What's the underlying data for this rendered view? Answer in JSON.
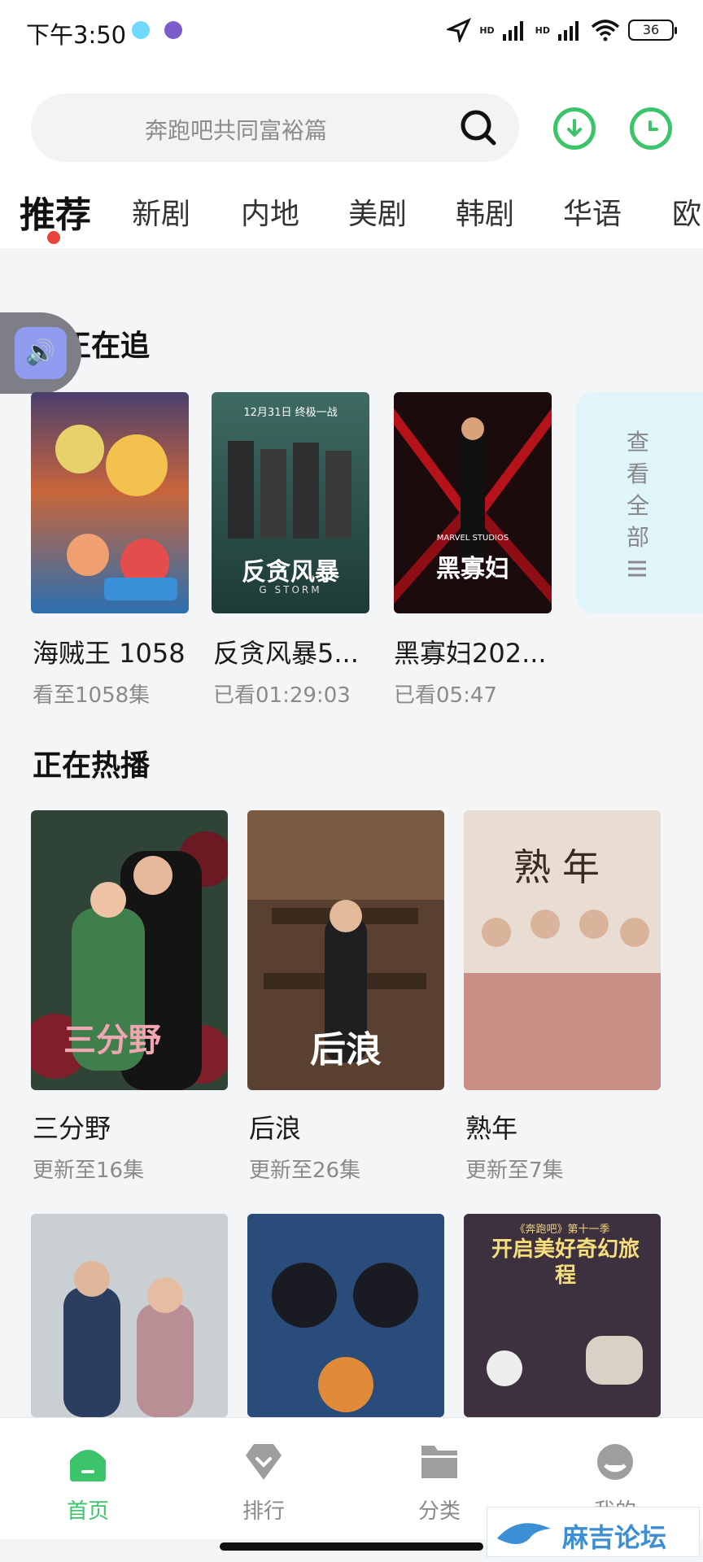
{
  "status_bar": {
    "time": "下午3:50",
    "signal_1": "HD",
    "signal_2": "HD",
    "battery": "36"
  },
  "search": {
    "placeholder": "奔跑吧共同富裕篇"
  },
  "header_icons": [
    "download-icon",
    "history-icon"
  ],
  "tabs": [
    {
      "label": "推荐",
      "active": true
    },
    {
      "label": "新剧"
    },
    {
      "label": "内地"
    },
    {
      "label": "美剧"
    },
    {
      "label": "韩剧"
    },
    {
      "label": "华语"
    },
    {
      "label": "欧"
    }
  ],
  "float_badge": {
    "glyph": "🔊"
  },
  "following": {
    "title": "我正在追",
    "items": [
      {
        "title": "海贼王 1058",
        "sub": "看至1058集"
      },
      {
        "title": "反贪风暴5...",
        "sub": "已看01:29:03"
      },
      {
        "title": "黑寡妇202...",
        "sub": "已看05:47"
      }
    ],
    "view_all": "查看全部",
    "view_all_icon": "list-icon",
    "poster_text": [
      {
        "main": "",
        "small": ""
      },
      {
        "main": "反贪风暴",
        "small": "G STORM",
        "top": "12月31日 终极一战"
      },
      {
        "main": "黑寡妇",
        "small": "MARVEL STUDIOS"
      }
    ]
  },
  "hot": {
    "title": "正在热播",
    "items": [
      {
        "title": "三分野",
        "sub": "更新至16集"
      },
      {
        "title": "后浪",
        "sub": "更新至26集"
      },
      {
        "title": "熟年",
        "sub": "更新至7集"
      }
    ],
    "poster_text": [
      {
        "main": "三分野"
      },
      {
        "main": "后浪"
      },
      {
        "main": "熟年"
      }
    ],
    "more_posters": [
      {
        "main": ""
      },
      {
        "main": ""
      },
      {
        "main": "开启美好奇幻旅程",
        "top": "《奔跑吧》第十一季"
      }
    ]
  },
  "bottom_nav": [
    {
      "label": "首页",
      "icon": "home-icon",
      "active": true
    },
    {
      "label": "排行",
      "icon": "rank-icon"
    },
    {
      "label": "分类",
      "icon": "folder-icon"
    },
    {
      "label": "我的",
      "icon": "profile-icon"
    }
  ],
  "watermark": {
    "text": "麻吉论坛"
  },
  "colors": {
    "accent": "#3cc46a",
    "tab_dot": "#e8423a",
    "view_all_bg": "#dff5f9"
  }
}
